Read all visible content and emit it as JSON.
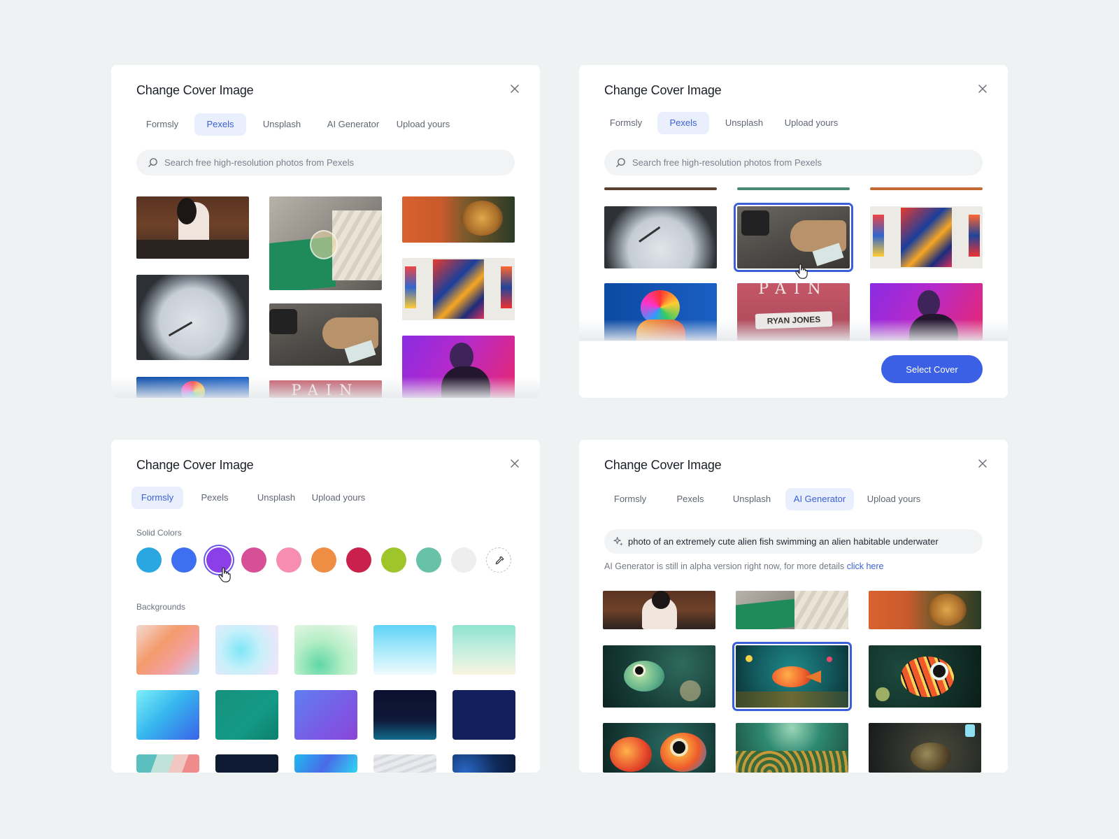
{
  "colors": {
    "accent": "#3b5fd9",
    "primary_button": "#3b5fe5",
    "active_tab_bg": "#e9effd",
    "background": "#eff2f3"
  },
  "modal1": {
    "title": "Change Cover Image",
    "tabs": [
      {
        "label": "Formsly"
      },
      {
        "label": "Pexels",
        "active": true
      },
      {
        "label": "Unsplash"
      },
      {
        "label": "AI Generator"
      },
      {
        "label": "Upload yours"
      }
    ],
    "search_placeholder": "Search free high-resolution photos from Pexels",
    "photos": [
      "person-writing-photo",
      "glass-and-book-photo",
      "salmon-dish-photo",
      "wall-clock-photo",
      "legs-and-bag-photo",
      "gallery-painting-photo",
      "colorful-portrait-photo",
      "pain-text-photo",
      "neon-portrait-photo"
    ],
    "photo_text": "PAIN"
  },
  "modal2": {
    "title": "Change Cover Image",
    "tabs": [
      {
        "label": "Formsly"
      },
      {
        "label": "Pexels",
        "active": true
      },
      {
        "label": "Unsplash"
      },
      {
        "label": "Upload yours"
      }
    ],
    "search_placeholder": "Search free high-resolution photos from Pexels",
    "photos": [
      "wall-clock-photo",
      "legs-and-bag-photo",
      "gallery-painting-photo",
      "colorful-portrait-photo",
      "ryan-jones-photo",
      "neon-portrait-photo"
    ],
    "selected_photo": "legs-and-bag-photo",
    "photo_text_top": "PAIN",
    "photo_text_banner": "RYAN JONES",
    "select_button": "Select Cover"
  },
  "modal3": {
    "title": "Change Cover Image",
    "tabs": [
      {
        "label": "Formsly",
        "active": true
      },
      {
        "label": "Pexels"
      },
      {
        "label": "Unsplash"
      },
      {
        "label": "Upload yours"
      }
    ],
    "solid_colors_label": "Solid Colors",
    "solid_colors": [
      "#2aa6e0",
      "#3e6ff0",
      "#8b3fe6",
      "#d64f97",
      "#f78db0",
      "#ee8e45",
      "#c9214c",
      "#9ec62b",
      "#67c2a7",
      "#eeeeee"
    ],
    "selected_color": "#8b3fe6",
    "eyedropper_icon": "eyedropper-icon",
    "backgrounds_label": "Backgrounds"
  },
  "modal4": {
    "title": "Change Cover Image",
    "tabs": [
      {
        "label": "Formsly"
      },
      {
        "label": "Pexels"
      },
      {
        "label": "Unsplash"
      },
      {
        "label": "AI Generator",
        "active": true
      },
      {
        "label": "Upload yours"
      }
    ],
    "prompt_value": "photo of an extremely cute alien fish swimming an alien habitable underwater",
    "note_text": "AI Generator is still in alpha version right now, for more details ",
    "note_link": "click here",
    "photos": [
      "person-writing-photo",
      "glass-and-book-photo",
      "salmon-dish-photo",
      "green-fish-photo",
      "orange-fish-photo",
      "red-fish-photo",
      "two-fish-photo",
      "reef-photo",
      "dark-fish-photo"
    ],
    "selected_photo": "orange-fish-photo"
  }
}
